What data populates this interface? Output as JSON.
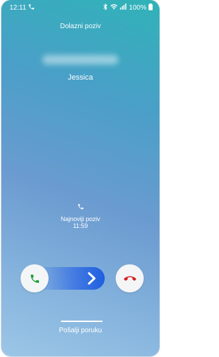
{
  "status_bar": {
    "time": "12:11",
    "battery": "100%",
    "icons": [
      "phone-icon",
      "bluetooth-icon",
      "wifi-icon",
      "signal-icon",
      "battery-icon"
    ]
  },
  "call": {
    "label": "Dolazni poziv",
    "caller_name": "Jessica"
  },
  "recent_call": {
    "label": "Najnoviji poziv",
    "time": "11:59"
  },
  "actions": {
    "answer_icon": "phone-answer-icon",
    "decline_icon": "phone-decline-icon",
    "answer_color": "#1e9e3a",
    "decline_color": "#d61f1f",
    "swipe_color": "#1f5fe0"
  },
  "message": {
    "label": "Pošalji poruku"
  }
}
